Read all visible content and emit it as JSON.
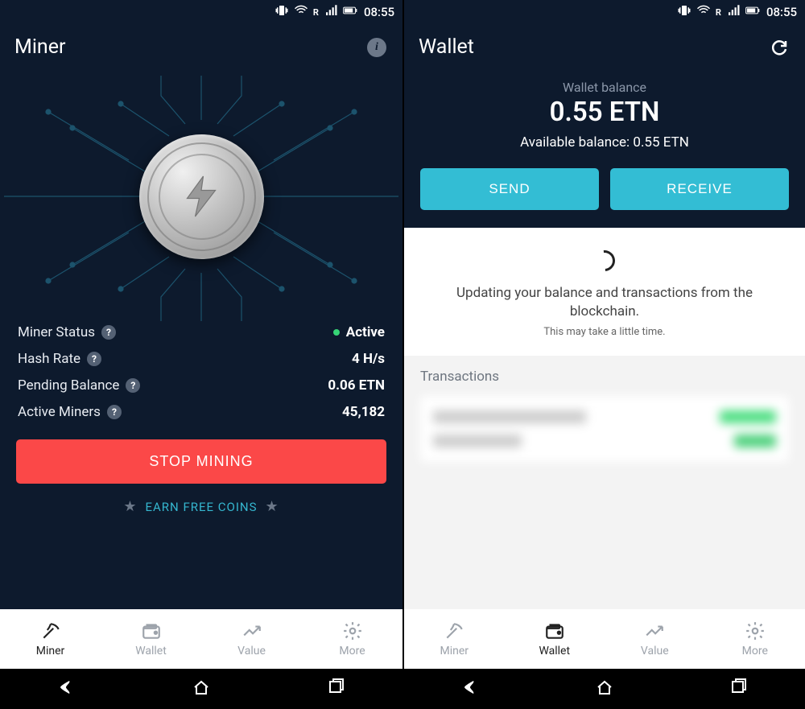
{
  "status": {
    "time": "08:55"
  },
  "miner": {
    "title": "Miner",
    "coin_name": "electroneum",
    "stats": {
      "status_label": "Miner Status",
      "status_value": "Active",
      "hash_label": "Hash Rate",
      "hash_value": "4 H/s",
      "pending_label": "Pending Balance",
      "pending_value": "0.06 ETN",
      "miners_label": "Active Miners",
      "miners_value": "45,182"
    },
    "stop_label": "STOP MINING",
    "earn_label": "EARN FREE COINS"
  },
  "wallet": {
    "title": "Wallet",
    "balance_label": "Wallet balance",
    "balance_value": "0.55 ETN",
    "available_label": "Available balance: 0.55 ETN",
    "send_label": "SEND",
    "receive_label": "RECEIVE",
    "updating_line1": "Updating your balance and transactions from the blockchain.",
    "updating_line2": "This may take a little time.",
    "tx_heading": "Transactions"
  },
  "tabs": {
    "miner": "Miner",
    "wallet": "Wallet",
    "value": "Value",
    "more": "More"
  }
}
